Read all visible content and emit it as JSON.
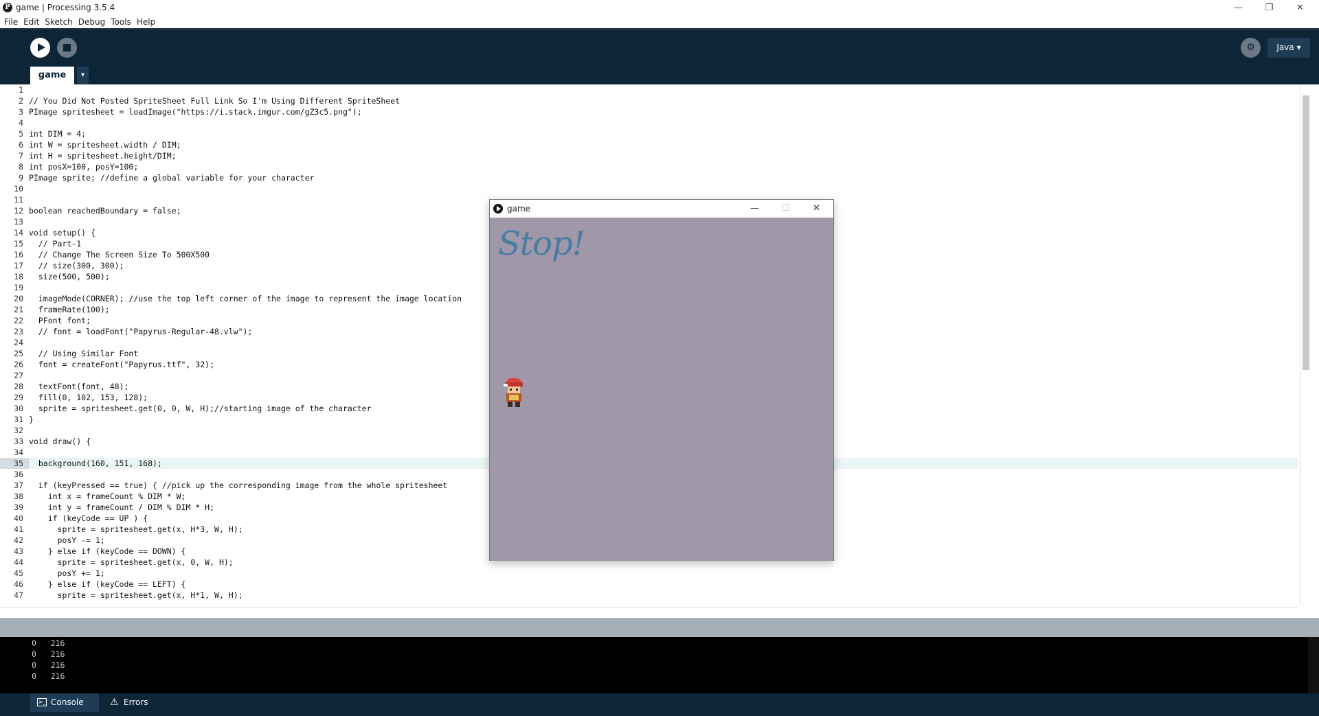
{
  "window": {
    "title": "game | Processing 3.5.4",
    "minimize": "—",
    "restore": "❐",
    "close": "✕"
  },
  "menu": [
    "File",
    "Edit",
    "Sketch",
    "Debug",
    "Tools",
    "Help"
  ],
  "toolbar": {
    "tab_label": "game",
    "tab_menu": "▾",
    "mode_label": "Java ▾",
    "debug_icon": "debug-icon"
  },
  "code_lines": [
    "",
    "// You Did Not Posted SpriteSheet Full Link So I'm Using Different SpriteSheet",
    "PImage spritesheet = loadImage(\"https://i.stack.imgur.com/gZ3c5.png\");",
    "",
    "int DIM = 4;",
    "int W = spritesheet.width / DIM;",
    "int H = spritesheet.height/DIM;",
    "int posX=100, posY=100;",
    "PImage sprite; //define a global variable for your character",
    "",
    "",
    "boolean reachedBoundary = false;",
    "",
    "void setup() {",
    "  // Part-1",
    "  // Change The Screen Size To 500X500",
    "  // size(300, 300);",
    "  size(500, 500);",
    "",
    "  imageMode(CORNER); //use the top left corner of the image to represent the image location",
    "  frameRate(100);",
    "  PFont font;",
    "  // font = loadFont(\"Papyrus-Regular-48.vlw\");",
    "",
    "  // Using Similar Font",
    "  font = createFont(\"Papyrus.ttf\", 32);",
    "",
    "  textFont(font, 48);",
    "  fill(0, 102, 153, 128);",
    "  sprite = spritesheet.get(0, 0, W, H);//starting image of the character",
    "}",
    "",
    "void draw() {",
    "",
    "  background(160, 151, 168);",
    "",
    "  if (keyPressed == true) { //pick up the corresponding image from the whole spritesheet",
    "    int x = frameCount % DIM * W;",
    "    int y = frameCount / DIM % DIM * H;",
    "    if (keyCode == UP ) {",
    "      sprite = spritesheet.get(x, H*3, W, H);",
    "      posY -= 1;",
    "    } else if (keyCode == DOWN) {",
    "      sprite = spritesheet.get(x, 0, W, H);",
    "      posY += 1;",
    "    } else if (keyCode == LEFT) {",
    "      sprite = spritesheet.get(x, H*1, W, H);"
  ],
  "current_line": 35,
  "console_lines": [
    "0   216",
    "0   216",
    "0   216",
    "0   216"
  ],
  "bottom_tabs": {
    "console": "Console",
    "errors": "Errors"
  },
  "sketch_window": {
    "title": "game",
    "minimize": "—",
    "maximize": "☐",
    "close": "✕",
    "canvas_text": "Stop!",
    "background_color": "#a097a8",
    "text_color": "#0066a0"
  },
  "colors": {
    "toolbar": "#0e2437",
    "tab_accent": "#1e3c55",
    "current_line": "#eaf6f6"
  }
}
